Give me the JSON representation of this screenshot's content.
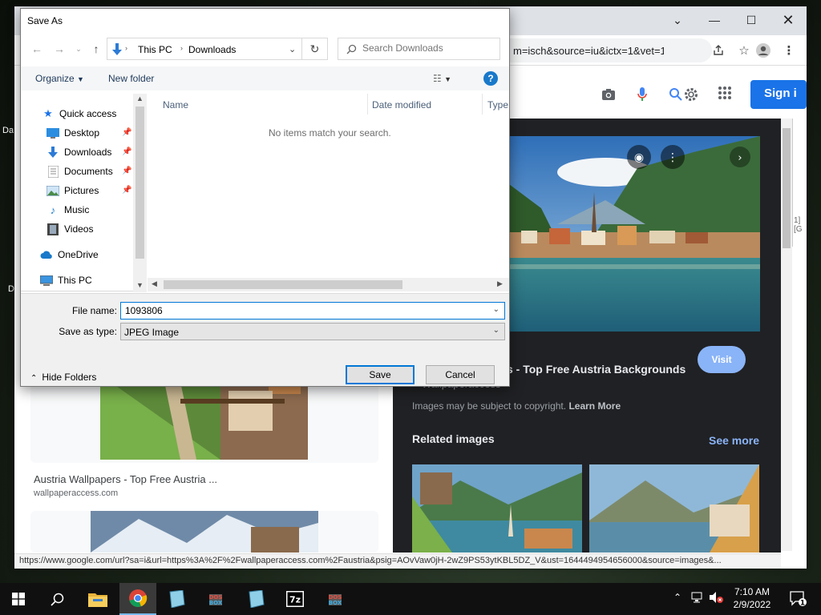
{
  "desktop": {
    "frag1": "Da",
    "frag2": "D"
  },
  "chrome": {
    "url": "m=isch&source=iu&ictx=1&vet=1...",
    "signin_label": "Sign i",
    "results": [
      {
        "title": "Austria Wallpapers - Top Free Austria ...",
        "site": "wallpaperaccess.com"
      }
    ],
    "preview": {
      "title": "s - Top Free Austria Backgrounds",
      "site": "Wallpaperaccess",
      "copyright_text": "Images may be subject to copyright.",
      "learn_more": "Learn More",
      "visit_label": "Visit",
      "related_label": "Related images",
      "see_more_label": "See more"
    },
    "side_strip_text": "1] [G",
    "status_url": "https://www.google.com/url?sa=i&url=https%3A%2F%2Fwallpaperaccess.com%2Faustria&psig=AOvVaw0jH-2wZ9PS53ytKBL5DZ_V&ust=1644494954656000&source=images&..."
  },
  "dialog": {
    "title": "Save As",
    "breadcrumb": [
      "This PC",
      "Downloads"
    ],
    "search_placeholder": "Search Downloads",
    "toolbar": {
      "organize": "Organize",
      "new_folder": "New folder"
    },
    "nav": {
      "quick_access": "Quick access",
      "items": [
        "Desktop",
        "Downloads",
        "Documents",
        "Pictures",
        "Music",
        "Videos"
      ],
      "onedrive": "OneDrive",
      "this_pc": "This PC"
    },
    "columns": [
      "Name",
      "Date modified",
      "Type"
    ],
    "empty_message": "No items match your search.",
    "file_name_label": "File name:",
    "file_name_value": "1093806",
    "save_type_label": "Save as type:",
    "save_type_value": "JPEG Image",
    "hide_folders": "Hide Folders",
    "save_label": "Save",
    "cancel_label": "Cancel"
  },
  "taskbar": {
    "time": "7:10 AM",
    "date": "2/9/2022",
    "notification_count": "1"
  },
  "colors": {
    "accent": "#0078d7",
    "google_blue": "#1a73e8",
    "preview_bg": "#202124"
  }
}
